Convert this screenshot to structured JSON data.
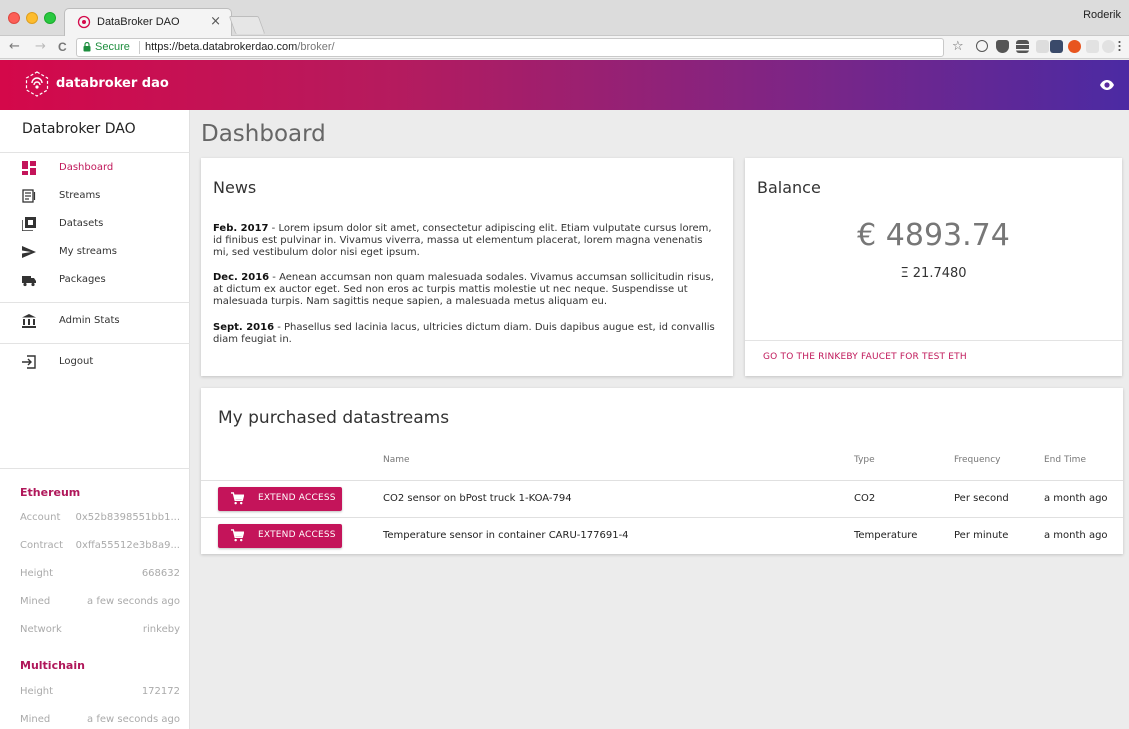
{
  "browser": {
    "tab_title": "DataBroker DAO",
    "tab_close": "×",
    "user_name": "Roderik",
    "secure_label": "Secure",
    "url_host": "https://beta.databrokerdao.com",
    "url_path": "/broker/",
    "back": "←",
    "forward": "→",
    "reload": "C",
    "star": "☆"
  },
  "appbar": {
    "brand": "databroker dao"
  },
  "sidebar": {
    "title": "Databroker DAO",
    "items": [
      {
        "label": "Dashboard",
        "icon": "dashboard-icon"
      },
      {
        "label": "Streams",
        "icon": "streams-icon"
      },
      {
        "label": "Datasets",
        "icon": "datasets-icon"
      },
      {
        "label": "My streams",
        "icon": "send-icon"
      },
      {
        "label": "Packages",
        "icon": "truck-icon"
      },
      {
        "label": "Admin Stats",
        "icon": "bank-icon"
      },
      {
        "label": "Logout",
        "icon": "logout-icon"
      }
    ],
    "ethereum": {
      "heading": "Ethereum",
      "rows": [
        {
          "key": "Account",
          "value": "0x52b8398551bb1..."
        },
        {
          "key": "Contract",
          "value": "0xffa55512e3b8a9..."
        },
        {
          "key": "Height",
          "value": "668632"
        },
        {
          "key": "Mined",
          "value": "a few seconds ago"
        },
        {
          "key": "Network",
          "value": "rinkeby"
        }
      ]
    },
    "multichain": {
      "heading": "Multichain",
      "rows": [
        {
          "key": "Height",
          "value": "172172"
        },
        {
          "key": "Mined",
          "value": "a few seconds ago"
        }
      ]
    }
  },
  "main": {
    "title": "Dashboard",
    "news": {
      "title": "News",
      "items": [
        {
          "date": "Feb. 2017",
          "text": " - Lorem ipsum dolor sit amet, consectetur adipiscing elit. Etiam vulputate cursus lorem, id finibus est pulvinar in. Vivamus viverra, massa ut elementum placerat, lorem magna venenatis mi, sed vestibulum dolor nisi eget ipsum."
        },
        {
          "date": "Dec. 2016",
          "text": " - Aenean accumsan non quam malesuada sodales. Vivamus accumsan sollicitudin risus, at dictum ex auctor eget. Sed non eros ac turpis mattis molestie ut nec neque. Suspendisse ut malesuada turpis. Nam sagittis neque sapien, a malesuada metus aliquam eu."
        },
        {
          "date": "Sept. 2016",
          "text": " - Phasellus sed lacinia lacus, ultricies dictum diam. Duis dapibus augue est, id convallis diam feugiat in."
        }
      ]
    },
    "balance": {
      "title": "Balance",
      "eur": "€ 4893.74",
      "eth": "Ξ 21.7480",
      "faucet_link": "GO TO THE RINKEBY FAUCET FOR TEST ETH"
    },
    "purchased": {
      "title": "My purchased datastreams",
      "columns": {
        "name": "Name",
        "type": "Type",
        "frequency": "Frequency",
        "end_time": "End Time"
      },
      "rows": [
        {
          "action": "EXTEND ACCESS",
          "name": "CO2 sensor on bPost truck 1-KOA-794",
          "type": "CO2",
          "frequency": "Per second",
          "end_time": "a month ago"
        },
        {
          "action": "EXTEND ACCESS",
          "name": "Temperature sensor in container CARU-177691-4",
          "type": "Temperature",
          "frequency": "Per minute",
          "end_time": "a month ago"
        }
      ]
    }
  },
  "colors": {
    "accent": "#c4145a",
    "gradient_start": "#d4084a",
    "gradient_end": "#4b2aa3"
  }
}
